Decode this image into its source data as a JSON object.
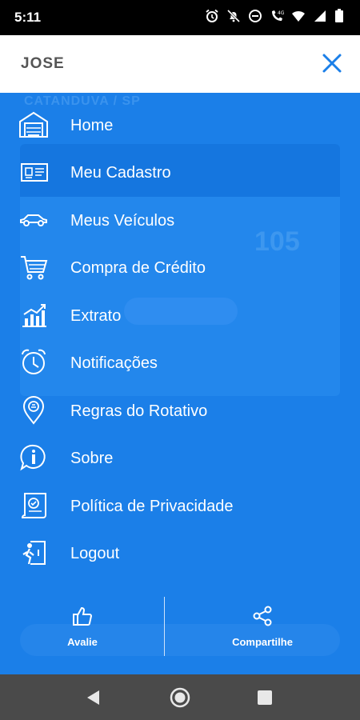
{
  "status_bar": {
    "time": "5:11",
    "icons": [
      "alarm-icon",
      "notifications-off-icon",
      "do-not-disturb-icon",
      "volte-call-icon",
      "wifi-icon",
      "signal-icon",
      "battery-icon"
    ]
  },
  "header": {
    "user_name": "JOSE",
    "close_icon": "close-icon",
    "accent_color": "#1b7fe8"
  },
  "background": {
    "city": "CATANDUVA / SP",
    "balance_number": "105"
  },
  "menu": {
    "items": [
      {
        "label": "Home",
        "icon": "garage-home-icon"
      },
      {
        "label": "Meu Cadastro",
        "icon": "id-card-icon"
      },
      {
        "label": "Meus Veículos",
        "icon": "car-icon"
      },
      {
        "label": "Compra de Crédito",
        "icon": "shopping-cart-icon"
      },
      {
        "label": "Extrato",
        "icon": "bar-chart-icon"
      },
      {
        "label": "Notificações",
        "icon": "alarm-clock-icon"
      },
      {
        "label": "Regras do Rotativo",
        "icon": "location-pin-icon"
      },
      {
        "label": "Sobre",
        "icon": "info-bubble-icon"
      },
      {
        "label": "Política de Privacidade",
        "icon": "privacy-certificate-icon"
      },
      {
        "label": "Logout",
        "icon": "logout-door-icon"
      }
    ]
  },
  "footer": {
    "rate_label": "Avalie",
    "share_label": "Compartilhe"
  },
  "nav_bar": {
    "buttons": [
      "back-icon",
      "home-circle-icon",
      "recents-icon"
    ]
  }
}
